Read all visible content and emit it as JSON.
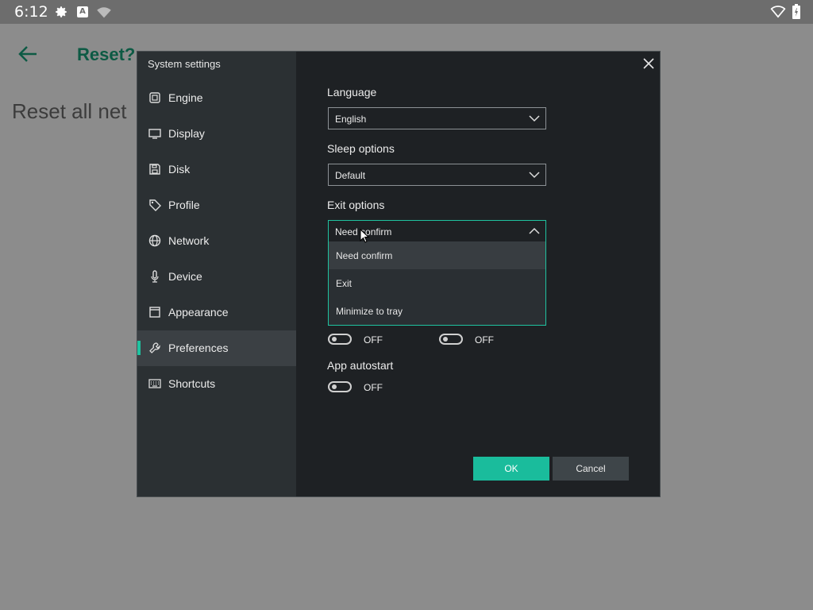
{
  "statusbar": {
    "time": "6:12",
    "a_icon": "A"
  },
  "background": {
    "title": "Reset?",
    "body": "Reset all net"
  },
  "dialog": {
    "title": "System settings",
    "nav": [
      {
        "label": "Engine",
        "icon": "chip-icon"
      },
      {
        "label": "Display",
        "icon": "monitor-icon"
      },
      {
        "label": "Disk",
        "icon": "disk-icon"
      },
      {
        "label": "Profile",
        "icon": "tag-icon"
      },
      {
        "label": "Network",
        "icon": "globe-icon"
      },
      {
        "label": "Device",
        "icon": "microphone-icon"
      },
      {
        "label": "Appearance",
        "icon": "window-icon"
      },
      {
        "label": "Preferences",
        "icon": "wrench-icon",
        "active": true
      },
      {
        "label": "Shortcuts",
        "icon": "keyboard-icon"
      }
    ],
    "language": {
      "label": "Language",
      "value": "English"
    },
    "sleep": {
      "label": "Sleep options",
      "value": "Default"
    },
    "exit": {
      "label": "Exit options",
      "value": "Need confirm",
      "options": [
        "Need confirm",
        "Exit",
        "Minimize to tray"
      ],
      "highlighted": "Need confirm"
    },
    "toggles": {
      "toggle1": "OFF",
      "toggle2": "OFF"
    },
    "autostart": {
      "label": "App autostart",
      "state": "OFF"
    },
    "buttons": {
      "ok": "OK",
      "cancel": "Cancel"
    }
  },
  "colors": {
    "accent": "#1fc3a0",
    "ok_button": "#1abc9c",
    "dialog_bg": "#1e2124",
    "sidebar_bg": "#2b3033"
  }
}
